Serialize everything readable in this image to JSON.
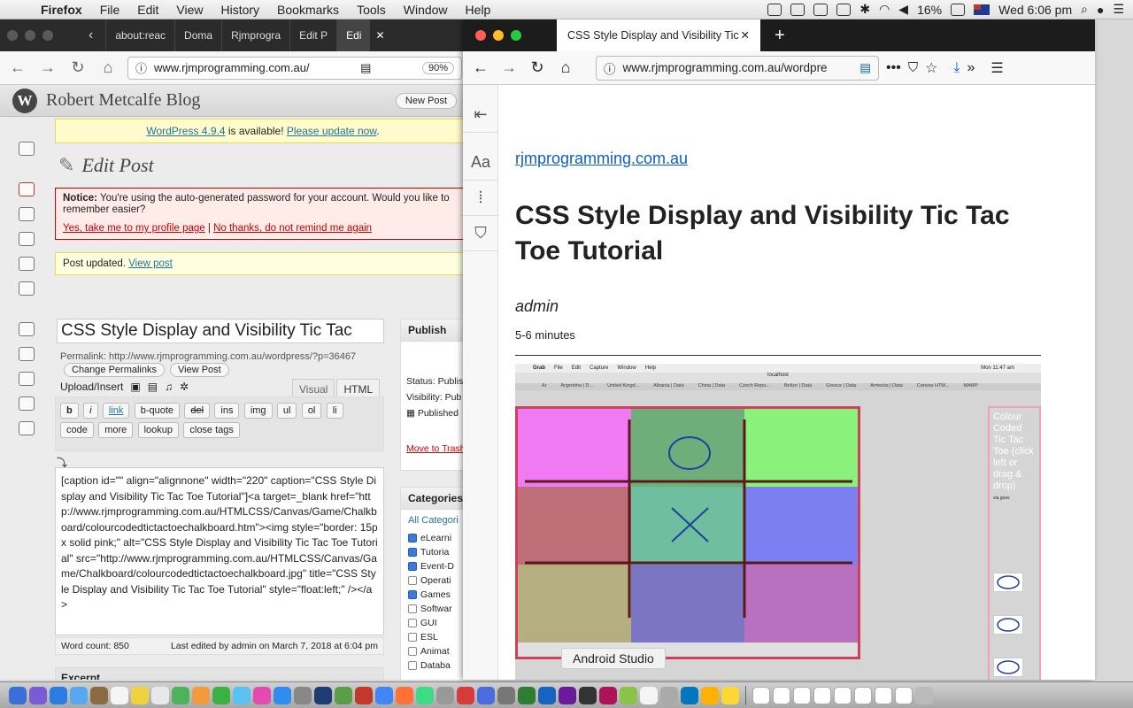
{
  "menubar": {
    "app": "Firefox",
    "items": [
      "File",
      "Edit",
      "View",
      "History",
      "Bookmarks",
      "Tools",
      "Window",
      "Help"
    ],
    "battery": "16%",
    "clock": "Wed 6:06 pm"
  },
  "left_window": {
    "tabs": [
      "about:reac",
      "Doma",
      "Rjmprogra",
      "Edit P",
      "Edi"
    ],
    "url": "www.rjmprogramming.com.au/",
    "zoom": "90%",
    "site_name": "Robert Metcalfe Blog",
    "new_post": "New Post",
    "update_notice": {
      "link1": "WordPress 4.9.4",
      "text": "is available!",
      "link2": "Please update now",
      "end": "."
    },
    "page_title": "Edit Post",
    "password_notice": {
      "label": "Notice:",
      "text": "You're using the auto-generated password for your account. Would you like to remember easier?",
      "yes": "Yes, take me to my profile page",
      "sep": "|",
      "no": "No thanks, do not remind me again"
    },
    "updated_notice": {
      "text": "Post updated.",
      "link": "View post"
    },
    "post_title": "CSS Style Display and Visibility Tic Tac",
    "permalink": "Permalink: http://www.rjmprogramming.com.au/wordpress/?p=36467",
    "change_permalinks": "Change Permalinks",
    "view_post": "View Post",
    "upload_insert": "Upload/Insert",
    "editor_tabs": [
      "Visual",
      "HTML"
    ],
    "quicktags": [
      "b",
      "i",
      "link",
      "b-quote",
      "del",
      "ins",
      "img",
      "ul",
      "ol",
      "li",
      "code",
      "more",
      "lookup",
      "close tags"
    ],
    "editor_text": "[caption id=\"\" align=\"alignnone\" width=\"220\" caption=\"CSS Style Display and Visibility Tic Tac Toe Tutorial\"]<a target=_blank href=\"http://www.rjmprogramming.com.au/HTMLCSS/Canvas/Game/Chalkboard/colourcodedtictactoechalkboard.htm\"><img style=\"border: 15px solid pink;\" alt=\"CSS Style Display and Visibility Tic Tac Toe Tutorial\" src=\"http://www.rjmprogramming.com.au/HTMLCSS/Canvas/Game/Chalkboard/colourcodedtictactoechalkboard.jpg\" title=\"CSS Style Display and Visibility Tic Tac Toe Tutorial\"  style=\"float:left;\" /></a>",
    "word_count": "Word count: 850",
    "last_edited": "Last edited by admin on March 7, 2018 at 6:04 pm",
    "excerpt": "Excerpt",
    "publish": {
      "title": "Publish",
      "status": "Status: Publis",
      "visibility": "Visibility: Pub",
      "published": "Published",
      "trash": "Move to Trash"
    },
    "categories": {
      "title": "Categories",
      "tab": "All Categori",
      "items": [
        {
          "label": "eLearni",
          "checked": true
        },
        {
          "label": "Tutoria",
          "checked": true
        },
        {
          "label": "Event-D",
          "checked": true
        },
        {
          "label": "Operati",
          "checked": false
        },
        {
          "label": "Games",
          "checked": true
        },
        {
          "label": "Softwar",
          "checked": false
        },
        {
          "label": "GUI",
          "checked": false
        },
        {
          "label": "ESL",
          "checked": false
        },
        {
          "label": "Animat",
          "checked": false
        },
        {
          "label": "Databa",
          "checked": false
        }
      ]
    }
  },
  "right_window": {
    "tab_title": "CSS Style Display and Visibility Tic",
    "url": "www.rjmprogramming.com.au/wordpre",
    "reader": {
      "domain": "rjmprogramming.com.au",
      "title": "CSS Style Display and Visibility Tic Tac Toe Tutorial",
      "author": "admin",
      "read_time": "5-6 minutes"
    },
    "screenshot": {
      "menu": [
        "Grab",
        "File",
        "Edit",
        "Capture",
        "Window",
        "Help"
      ],
      "clock": "Mon 11:47 am",
      "address": "localhost",
      "tabs": [
        "Ar",
        "Argentina | D...",
        "United Kingd...",
        "Albania | Data",
        "China | Data",
        "Czech Repu...",
        "Belize | Data",
        "Greece | Data",
        "Armenia | Data",
        "Canvas HTM...",
        "MAMP"
      ],
      "side_text": "Colour Coded Tic Tac Toe (click left or drag & drop)",
      "side_small": "via goes",
      "cell_colors": [
        "#f07af2",
        "#6fae7a",
        "#8af27a",
        "#bf6f78",
        "#6fbea0",
        "#7a80f0",
        "#b5ae80",
        "#7a76c4",
        "#b870bf"
      ]
    },
    "tooltip": "Android Studio"
  },
  "icons": {
    "apple": "apple-icon",
    "wp_logo": "wordpress-logo",
    "back": "back-arrow-icon",
    "forward": "forward-arrow-icon",
    "reload": "reload-icon",
    "home": "home-icon"
  }
}
